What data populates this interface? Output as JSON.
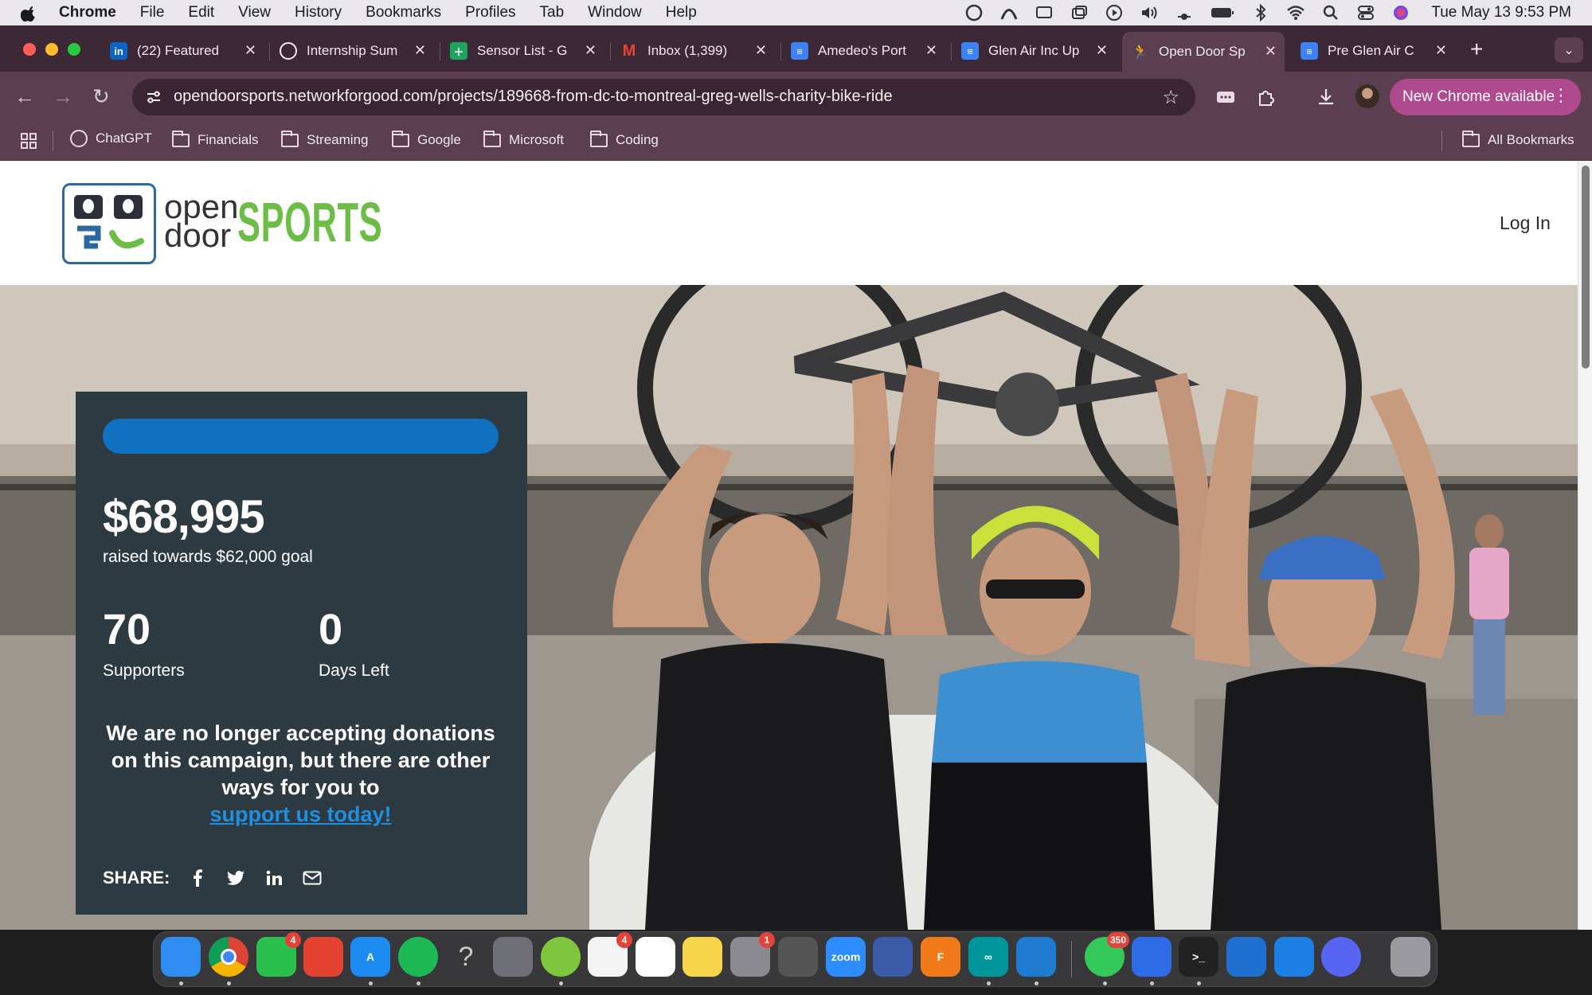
{
  "menubar": {
    "app": "Chrome",
    "items": [
      "File",
      "Edit",
      "View",
      "History",
      "Bookmarks",
      "Profiles",
      "Tab",
      "Window",
      "Help"
    ],
    "clock": "Tue May 13  9:53 PM"
  },
  "browser": {
    "tabs": [
      {
        "title": "(22) Featured",
        "favicon": "in",
        "color": "#0a66c2"
      },
      {
        "title": "Internship Sum",
        "favicon": "chatgpt",
        "color": "#ffffff"
      },
      {
        "title": "Sensor List - G",
        "favicon": "sheets",
        "color": "#1ea362"
      },
      {
        "title": "Inbox (1,399)",
        "favicon": "M",
        "color": "#ffffff"
      },
      {
        "title": "Amedeo's Port",
        "favicon": "docs",
        "color": "#3b82f6"
      },
      {
        "title": "Glen Air Inc Up",
        "favicon": "docs",
        "color": "#3b82f6"
      },
      {
        "title": "Open Door Sp",
        "favicon": "runner",
        "color": "#5b3f51",
        "active": true
      },
      {
        "title": "Pre Glen Air C",
        "favicon": "docs",
        "color": "#3b82f6"
      }
    ],
    "url": "opendoorsports.networkforgood.com/projects/189668-from-dc-to-montreal-greg-wells-charity-bike-ride",
    "update_label": "New Chrome available",
    "bookmarks": [
      {
        "label": "ChatGPT",
        "icon": "chatgpt-icon"
      },
      {
        "label": "Financials",
        "icon": "folder-icon"
      },
      {
        "label": "Streaming",
        "icon": "folder-icon"
      },
      {
        "label": "Google",
        "icon": "folder-icon"
      },
      {
        "label": "Microsoft",
        "icon": "folder-icon"
      },
      {
        "label": "Coding",
        "icon": "folder-icon"
      }
    ],
    "all_bookmarks": "All Bookmarks"
  },
  "site": {
    "logo_open": "open",
    "logo_door": "door",
    "logo_sports": "SPORTS",
    "login": "Log In"
  },
  "campaign": {
    "progress": 1.0,
    "raised": "$68,995",
    "raised_sub": "raised towards $62,000 goal",
    "supporters_count": "70",
    "supporters_label": "Supporters",
    "days_count": "0",
    "days_label": "Days Left",
    "notice": "We are no longer accepting donations on this campaign, but there are other ways for you to",
    "notice_link": "support us today!",
    "share_label": "SHARE:",
    "share_icons": [
      "facebook-icon",
      "twitter-icon",
      "linkedin-icon",
      "email-icon"
    ]
  },
  "dock": {
    "apps": [
      {
        "name": "finder",
        "color": "#2f8cf0",
        "label": ""
      },
      {
        "name": "chrome",
        "color": "#e6e6e6",
        "label": ""
      },
      {
        "name": "facetime",
        "color": "#2bc04e",
        "label": "",
        "badge": "4"
      },
      {
        "name": "todoist",
        "color": "#e44332",
        "label": ""
      },
      {
        "name": "app-store",
        "color": "#1c8cf2",
        "label": "A"
      },
      {
        "name": "spotify",
        "color": "#1db954",
        "label": ""
      },
      {
        "name": "help",
        "color": "transparent",
        "label": "?"
      },
      {
        "name": "launchpad",
        "color": "#6f6f77",
        "label": ""
      },
      {
        "name": "cloud-app",
        "color": "#7ec63c",
        "label": ""
      },
      {
        "name": "reminders",
        "color": "#f4f4f4",
        "label": "",
        "badge": "4"
      },
      {
        "name": "freeform",
        "color": "#ffffff",
        "label": ""
      },
      {
        "name": "notes",
        "color": "#f7d54a",
        "label": ""
      },
      {
        "name": "system-settings",
        "color": "#8a8a90",
        "label": "",
        "badge": "1"
      },
      {
        "name": "screenshot",
        "color": "#555",
        "label": ""
      },
      {
        "name": "zoom",
        "color": "#2d8cff",
        "label": "zoom"
      },
      {
        "name": "rocket",
        "color": "#3b5aa8",
        "label": ""
      },
      {
        "name": "fusion",
        "color": "#f07a1a",
        "label": "F"
      },
      {
        "name": "arduino",
        "color": "#00979c",
        "label": "∞"
      },
      {
        "name": "vscode",
        "color": "#1e7bd0",
        "label": ""
      },
      {
        "name": "messages",
        "color": "#34c759",
        "label": "",
        "badge": "350"
      },
      {
        "name": "copilot",
        "color": "#2e6be6",
        "label": ""
      },
      {
        "name": "terminal",
        "color": "#222",
        "label": ">_"
      },
      {
        "name": "remote-desktop",
        "color": "#1f6fd1",
        "label": ""
      },
      {
        "name": "windows-app",
        "color": "#1b7fe3",
        "label": ""
      },
      {
        "name": "discord",
        "color": "#5865f2",
        "label": ""
      },
      {
        "name": "trash",
        "color": "#9a9aa0",
        "label": ""
      }
    ]
  }
}
